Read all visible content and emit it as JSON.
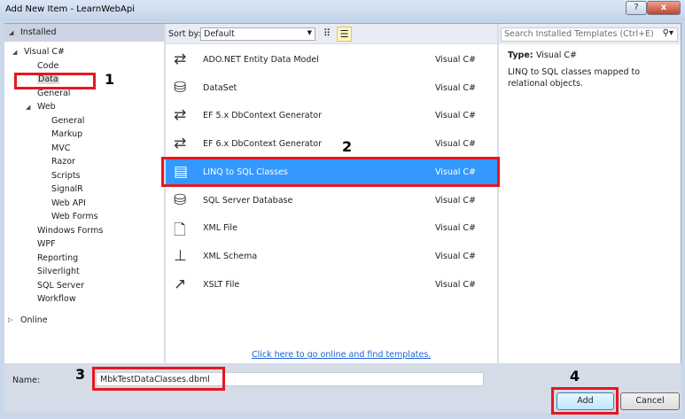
{
  "window": {
    "title": "Add New Item - LearnWebApi",
    "help": "?",
    "close": "x"
  },
  "left": {
    "installed": "Installed",
    "online": "Online",
    "tree": [
      {
        "label": "Visual C#",
        "level": 0,
        "expanded": true
      },
      {
        "label": "Code",
        "level": 1
      },
      {
        "label": "Data",
        "level": 1,
        "selected": true
      },
      {
        "label": "General",
        "level": 1
      },
      {
        "label": "Web",
        "level": 1,
        "expanded": true
      },
      {
        "label": "General",
        "level": 2
      },
      {
        "label": "Markup",
        "level": 2
      },
      {
        "label": "MVC",
        "level": 2
      },
      {
        "label": "Razor",
        "level": 2
      },
      {
        "label": "Scripts",
        "level": 2
      },
      {
        "label": "SignalR",
        "level": 2
      },
      {
        "label": "Web API",
        "level": 2
      },
      {
        "label": "Web Forms",
        "level": 2
      },
      {
        "label": "Windows Forms",
        "level": 1
      },
      {
        "label": "WPF",
        "level": 1
      },
      {
        "label": "Reporting",
        "level": 1
      },
      {
        "label": "Silverlight",
        "level": 1
      },
      {
        "label": "SQL Server",
        "level": 1
      },
      {
        "label": "Workflow",
        "level": 1
      }
    ]
  },
  "toolbar": {
    "sort_label": "Sort by:",
    "sort_value": "Default",
    "search_placeholder": "Search Installed Templates (Ctrl+E)"
  },
  "templates": [
    {
      "name": "ADO.NET Entity Data Model",
      "type": "Visual C#",
      "icon": "entity-model-icon"
    },
    {
      "name": "DataSet",
      "type": "Visual C#",
      "icon": "dataset-icon"
    },
    {
      "name": "EF 5.x DbContext Generator",
      "type": "Visual C#",
      "icon": "ef-generator-icon"
    },
    {
      "name": "EF 6.x DbContext Generator",
      "type": "Visual C#",
      "icon": "ef-generator-icon"
    },
    {
      "name": "LINQ to SQL Classes",
      "type": "Visual C#",
      "icon": "linq-to-sql-icon",
      "selected": true
    },
    {
      "name": "SQL Server Database",
      "type": "Visual C#",
      "icon": "database-icon"
    },
    {
      "name": "XML File",
      "type": "Visual C#",
      "icon": "xml-file-icon"
    },
    {
      "name": "XML Schema",
      "type": "Visual C#",
      "icon": "xml-schema-icon"
    },
    {
      "name": "XSLT File",
      "type": "Visual C#",
      "icon": "xslt-file-icon"
    }
  ],
  "online_link": "Click here to go online and find templates.",
  "details": {
    "type_label": "Type:",
    "type_value": "Visual C#",
    "description": "LINQ to SQL classes mapped to relational objects."
  },
  "bottom": {
    "name_label": "Name:",
    "name_value": "MbkTestDataClasses.dbml",
    "add": "Add",
    "cancel": "Cancel"
  },
  "annotations": [
    "1",
    "2",
    "3",
    "4"
  ],
  "colors": {
    "selection": "#3399ff",
    "annotation": "#e8161f"
  }
}
